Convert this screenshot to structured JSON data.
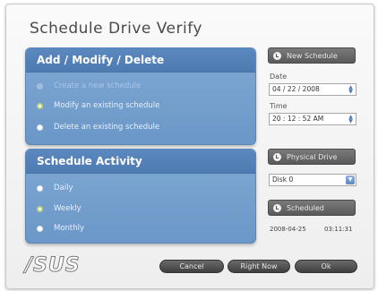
{
  "window": {
    "title": "Schedule Drive Verify"
  },
  "panel_add": {
    "header": "Add / Modify / Delete",
    "options": [
      {
        "label": "Create a new schedule",
        "state": "disabled"
      },
      {
        "label": "Modify an existing schedule",
        "state": "selected"
      },
      {
        "label": "Delete an existing schedule",
        "state": "normal"
      }
    ]
  },
  "panel_activity": {
    "header": "Schedule Activity",
    "options": [
      {
        "label": "Daily",
        "state": "normal"
      },
      {
        "label": "Weekly",
        "state": "selected"
      },
      {
        "label": "Monthly",
        "state": "normal"
      }
    ]
  },
  "side": {
    "new_schedule_label": "New Schedule",
    "date_label": "Date",
    "date_value": "04 / 22 / 2008",
    "time_label": "Time",
    "time_value": "20 : 12 : 52 AM",
    "physical_drive_label": "Physical Drive",
    "disk_value": "Disk 0",
    "scheduled_label": "Scheduled",
    "scheduled_date": "2008-04-25",
    "scheduled_time": "03:11:31"
  },
  "footer": {
    "logo_text": "/SUS",
    "cancel_label": "Cancel",
    "right_now_label": "Right Now",
    "ok_label": "Ok"
  },
  "colors": {
    "panel_blue": "#6b97c7",
    "header_blue": "#4d7ab1",
    "button_gray": "#5a5a5a"
  }
}
